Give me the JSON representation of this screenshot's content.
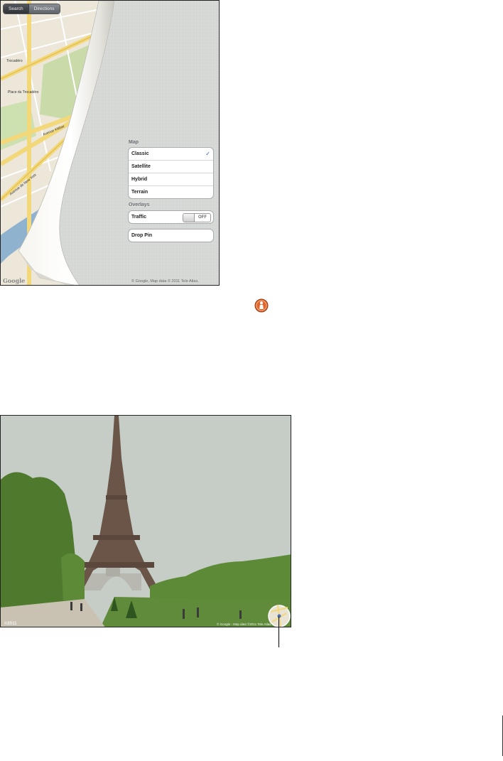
{
  "toolbar": {
    "tabs": [
      {
        "label": "Search",
        "active": true
      },
      {
        "label": "Directions",
        "active": false
      }
    ]
  },
  "map_options": {
    "heading": "Map",
    "items": [
      {
        "label": "Classic",
        "selected": true,
        "check": "✓"
      },
      {
        "label": "Satellite",
        "selected": false
      },
      {
        "label": "Hybrid",
        "selected": false
      },
      {
        "label": "Terrain",
        "selected": false
      }
    ]
  },
  "overlays": {
    "heading": "Overlays",
    "traffic_label": "Traffic",
    "traffic_state": "OFF"
  },
  "drop_pin_label": "Drop Pin",
  "map_attribution": "© Google,  Map data © 2011 Tele Atlas,",
  "map_logo": "Google",
  "map_labels": [
    {
      "text": "Avenue de New York"
    },
    {
      "text": "Trocadéro"
    },
    {
      "text": "Avenue Kléber"
    },
    {
      "text": "Place du Trocadéro"
    }
  ],
  "street_view": {
    "logo": "©2011",
    "attribution": "© Google - Map data ©2011 Tele Atlas"
  },
  "colors": {
    "map_road": "#f3d87a",
    "map_park": "#c8dba8",
    "river": "#8fb2cf",
    "linen": "#d6d8d6",
    "sky": "#c6cdc7",
    "trees": "#4f7a2e",
    "lawn": "#5f8b3a",
    "tower": "#6a5548",
    "sv_icon": "#e0632a"
  },
  "icons": {
    "street_view_button": "street-view-person-icon",
    "orientation_map": "mini-map-icon",
    "check": "check-icon"
  }
}
